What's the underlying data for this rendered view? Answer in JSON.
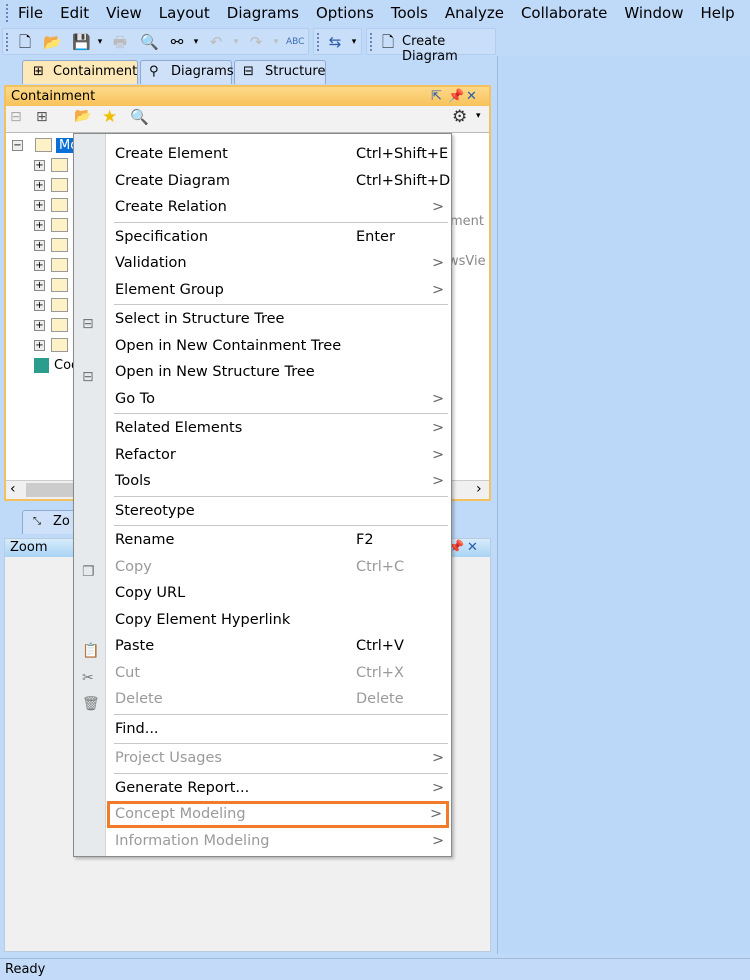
{
  "menubar": [
    "File",
    "Edit",
    "View",
    "Layout",
    "Diagrams",
    "Options",
    "Tools",
    "Analyze",
    "Collaborate",
    "Window",
    "Help"
  ],
  "toolbar": {
    "create_diagram": "Create Diagram"
  },
  "tabs": [
    "Containment",
    "Diagrams",
    "Structure"
  ],
  "containment": {
    "title": "Containment",
    "root": "Mod",
    "code_node": "Coo",
    "side_text": [
      "]",
      "ement",
      "]",
      "ewsVie"
    ]
  },
  "zoom": {
    "tab": "Zo",
    "title": "Zoom"
  },
  "status": "Ready",
  "context_menu": [
    {
      "label": "Create Element",
      "shortcut": "Ctrl+Shift+E"
    },
    {
      "label": "Create Diagram",
      "shortcut": "Ctrl+Shift+D"
    },
    {
      "label": "Create Relation",
      "submenu": true
    },
    {
      "sep": true
    },
    {
      "label": "Specification",
      "shortcut": "Enter"
    },
    {
      "label": "Validation",
      "submenu": true
    },
    {
      "label": "Element Group",
      "submenu": true
    },
    {
      "sep": true
    },
    {
      "label": "Select in Structure Tree",
      "icon": "structure-tree-icon"
    },
    {
      "label": "Open in New Containment Tree"
    },
    {
      "label": "Open in New Structure Tree",
      "icon": "structure-tree-icon"
    },
    {
      "label": "Go To",
      "submenu": true
    },
    {
      "sep": true
    },
    {
      "label": "Related Elements",
      "submenu": true
    },
    {
      "label": "Refactor",
      "submenu": true
    },
    {
      "label": "Tools",
      "submenu": true
    },
    {
      "sep": true
    },
    {
      "label": "Stereotype"
    },
    {
      "sep": true
    },
    {
      "label": "Rename",
      "shortcut": "F2"
    },
    {
      "label": "Copy",
      "shortcut": "Ctrl+C",
      "disabled": true,
      "icon": "copy-icon"
    },
    {
      "label": "Copy URL"
    },
    {
      "label": "Copy Element Hyperlink"
    },
    {
      "label": "Paste",
      "shortcut": "Ctrl+V",
      "icon": "paste-icon"
    },
    {
      "label": "Cut",
      "shortcut": "Ctrl+X",
      "disabled": true,
      "icon": "cut-icon"
    },
    {
      "label": "Delete",
      "shortcut": "Delete",
      "disabled": true,
      "icon": "trash-icon"
    },
    {
      "sep": true
    },
    {
      "label": "Find..."
    },
    {
      "sep": true
    },
    {
      "label": "Project Usages",
      "submenu": true,
      "disabled": true
    },
    {
      "sep": true
    },
    {
      "label": "Generate Report...",
      "submenu": true
    },
    {
      "label": "Concept Modeling",
      "submenu": true,
      "disabled": true,
      "highlighted": true
    },
    {
      "label": "Information Modeling",
      "submenu": true,
      "disabled": true
    }
  ],
  "colors": {
    "highlight": "#f07b28",
    "panel_border": "#f4c15f",
    "selection": "#0a6fd6"
  }
}
